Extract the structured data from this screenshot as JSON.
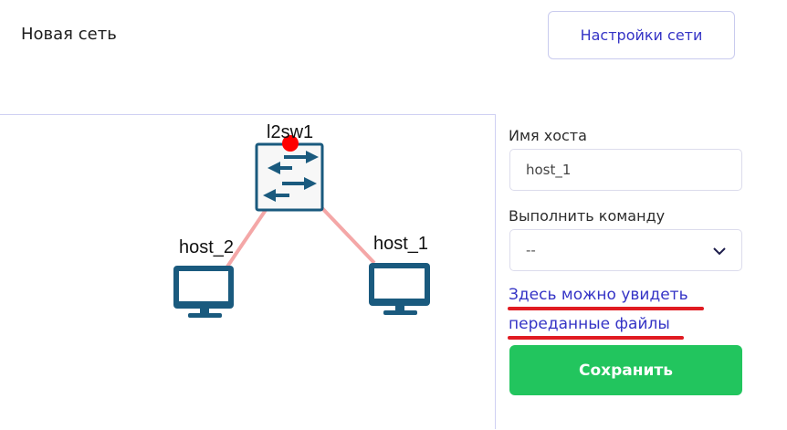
{
  "header": {
    "title": "Новая сеть",
    "settings_button": "Настройки сети"
  },
  "topology": {
    "switch": {
      "label": "l2sw1",
      "icon": "network-switch-icon",
      "status_color": "#ff0000"
    },
    "hosts": [
      {
        "label": "host_2",
        "icon": "monitor-icon"
      },
      {
        "label": "host_1",
        "icon": "monitor-icon"
      }
    ],
    "link_color": "#f4a7a7",
    "node_color": "#1a5a7e"
  },
  "panel": {
    "hostname_label": "Имя хоста",
    "hostname_value": "host_1",
    "command_label": "Выполнить команду",
    "command_value": "--",
    "files_link_line1": "Здесь можно увидеть",
    "files_link_line2": "переданные файлы",
    "save_button": "Сохранить"
  },
  "colors": {
    "accent": "#3534c6",
    "save": "#22c55e",
    "annotation": "#e01b22"
  }
}
